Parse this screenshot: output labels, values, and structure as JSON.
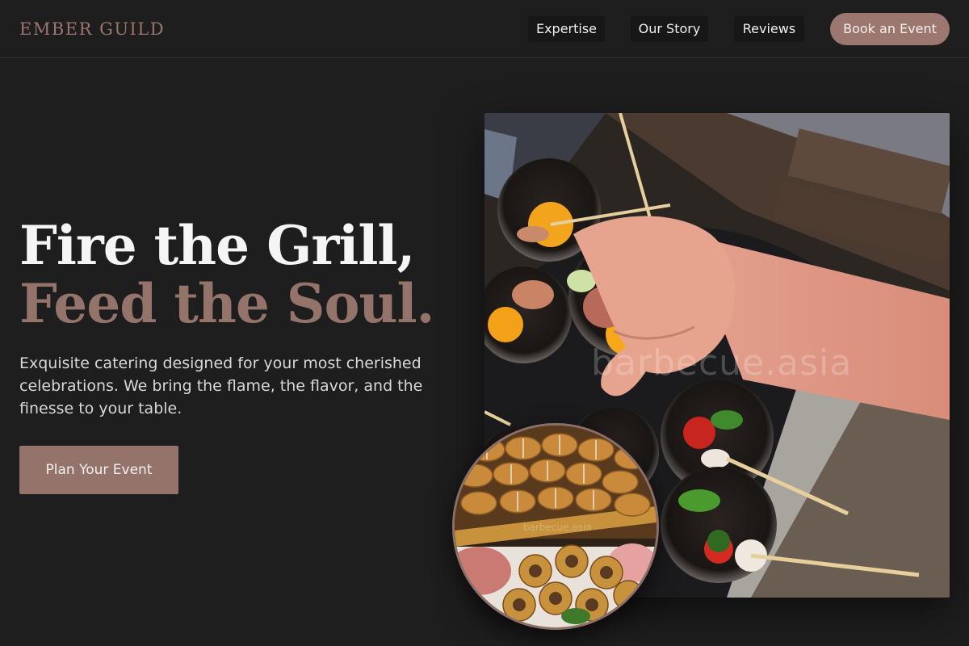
{
  "brand": {
    "name": "EMBER GUILD"
  },
  "nav": {
    "items": [
      {
        "label": "Expertise"
      },
      {
        "label": "Our Story"
      },
      {
        "label": "Reviews"
      }
    ],
    "cta_label": "Book an Event"
  },
  "hero": {
    "headline_line1": "Fire the Grill,",
    "headline_line2": "Feed the Soul.",
    "description": "Exquisite catering designed for your most cherished celebrations. We bring the flame, the flavor, and the finesse to your table.",
    "button_label": "Plan Your Event"
  },
  "images": {
    "main_watermark": "barbecue.asia",
    "circle_watermark": "barbecue.asia"
  },
  "colors": {
    "background": "#1e1e1e",
    "accent": "#94736b",
    "nav_button_bg": "#171717",
    "text_light": "#f5f5f5"
  }
}
